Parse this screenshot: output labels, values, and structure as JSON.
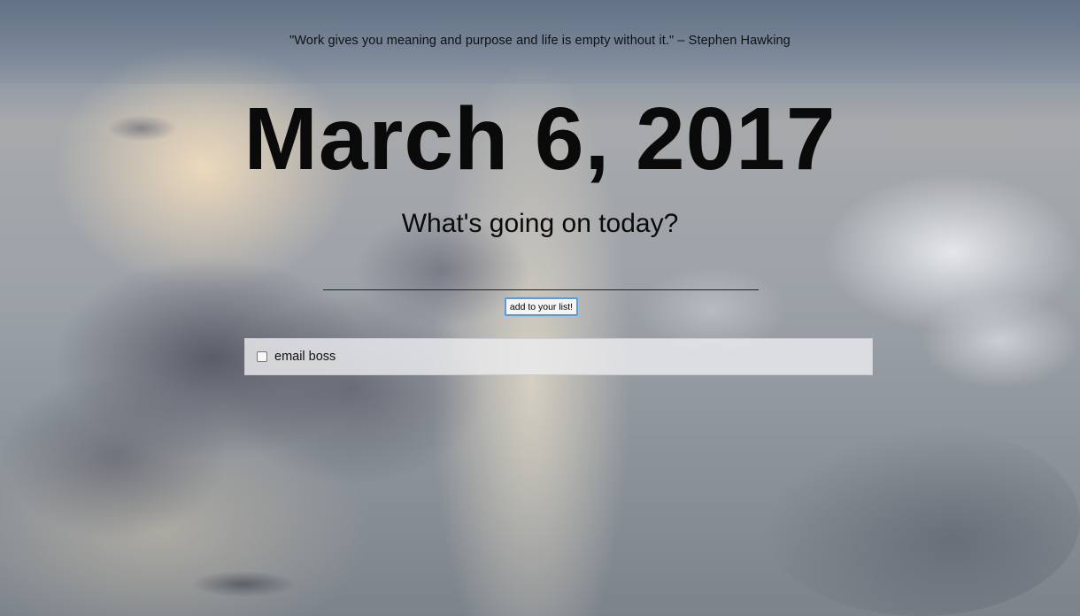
{
  "quote": {
    "text": "\"Work gives you meaning and purpose and life is empty without it.\" – Stephen Hawking"
  },
  "header": {
    "date": "March 6, 2017",
    "subtitle": "What's going on today?"
  },
  "form": {
    "input_value": "",
    "input_placeholder": "",
    "add_button_label": "add to your list!"
  },
  "todos": [
    {
      "label": "email boss",
      "checked": false
    }
  ],
  "colors": {
    "text": "#0a0a0a",
    "button_focus_ring": "#5b9dd9",
    "list_item_bg": "#ececee"
  }
}
